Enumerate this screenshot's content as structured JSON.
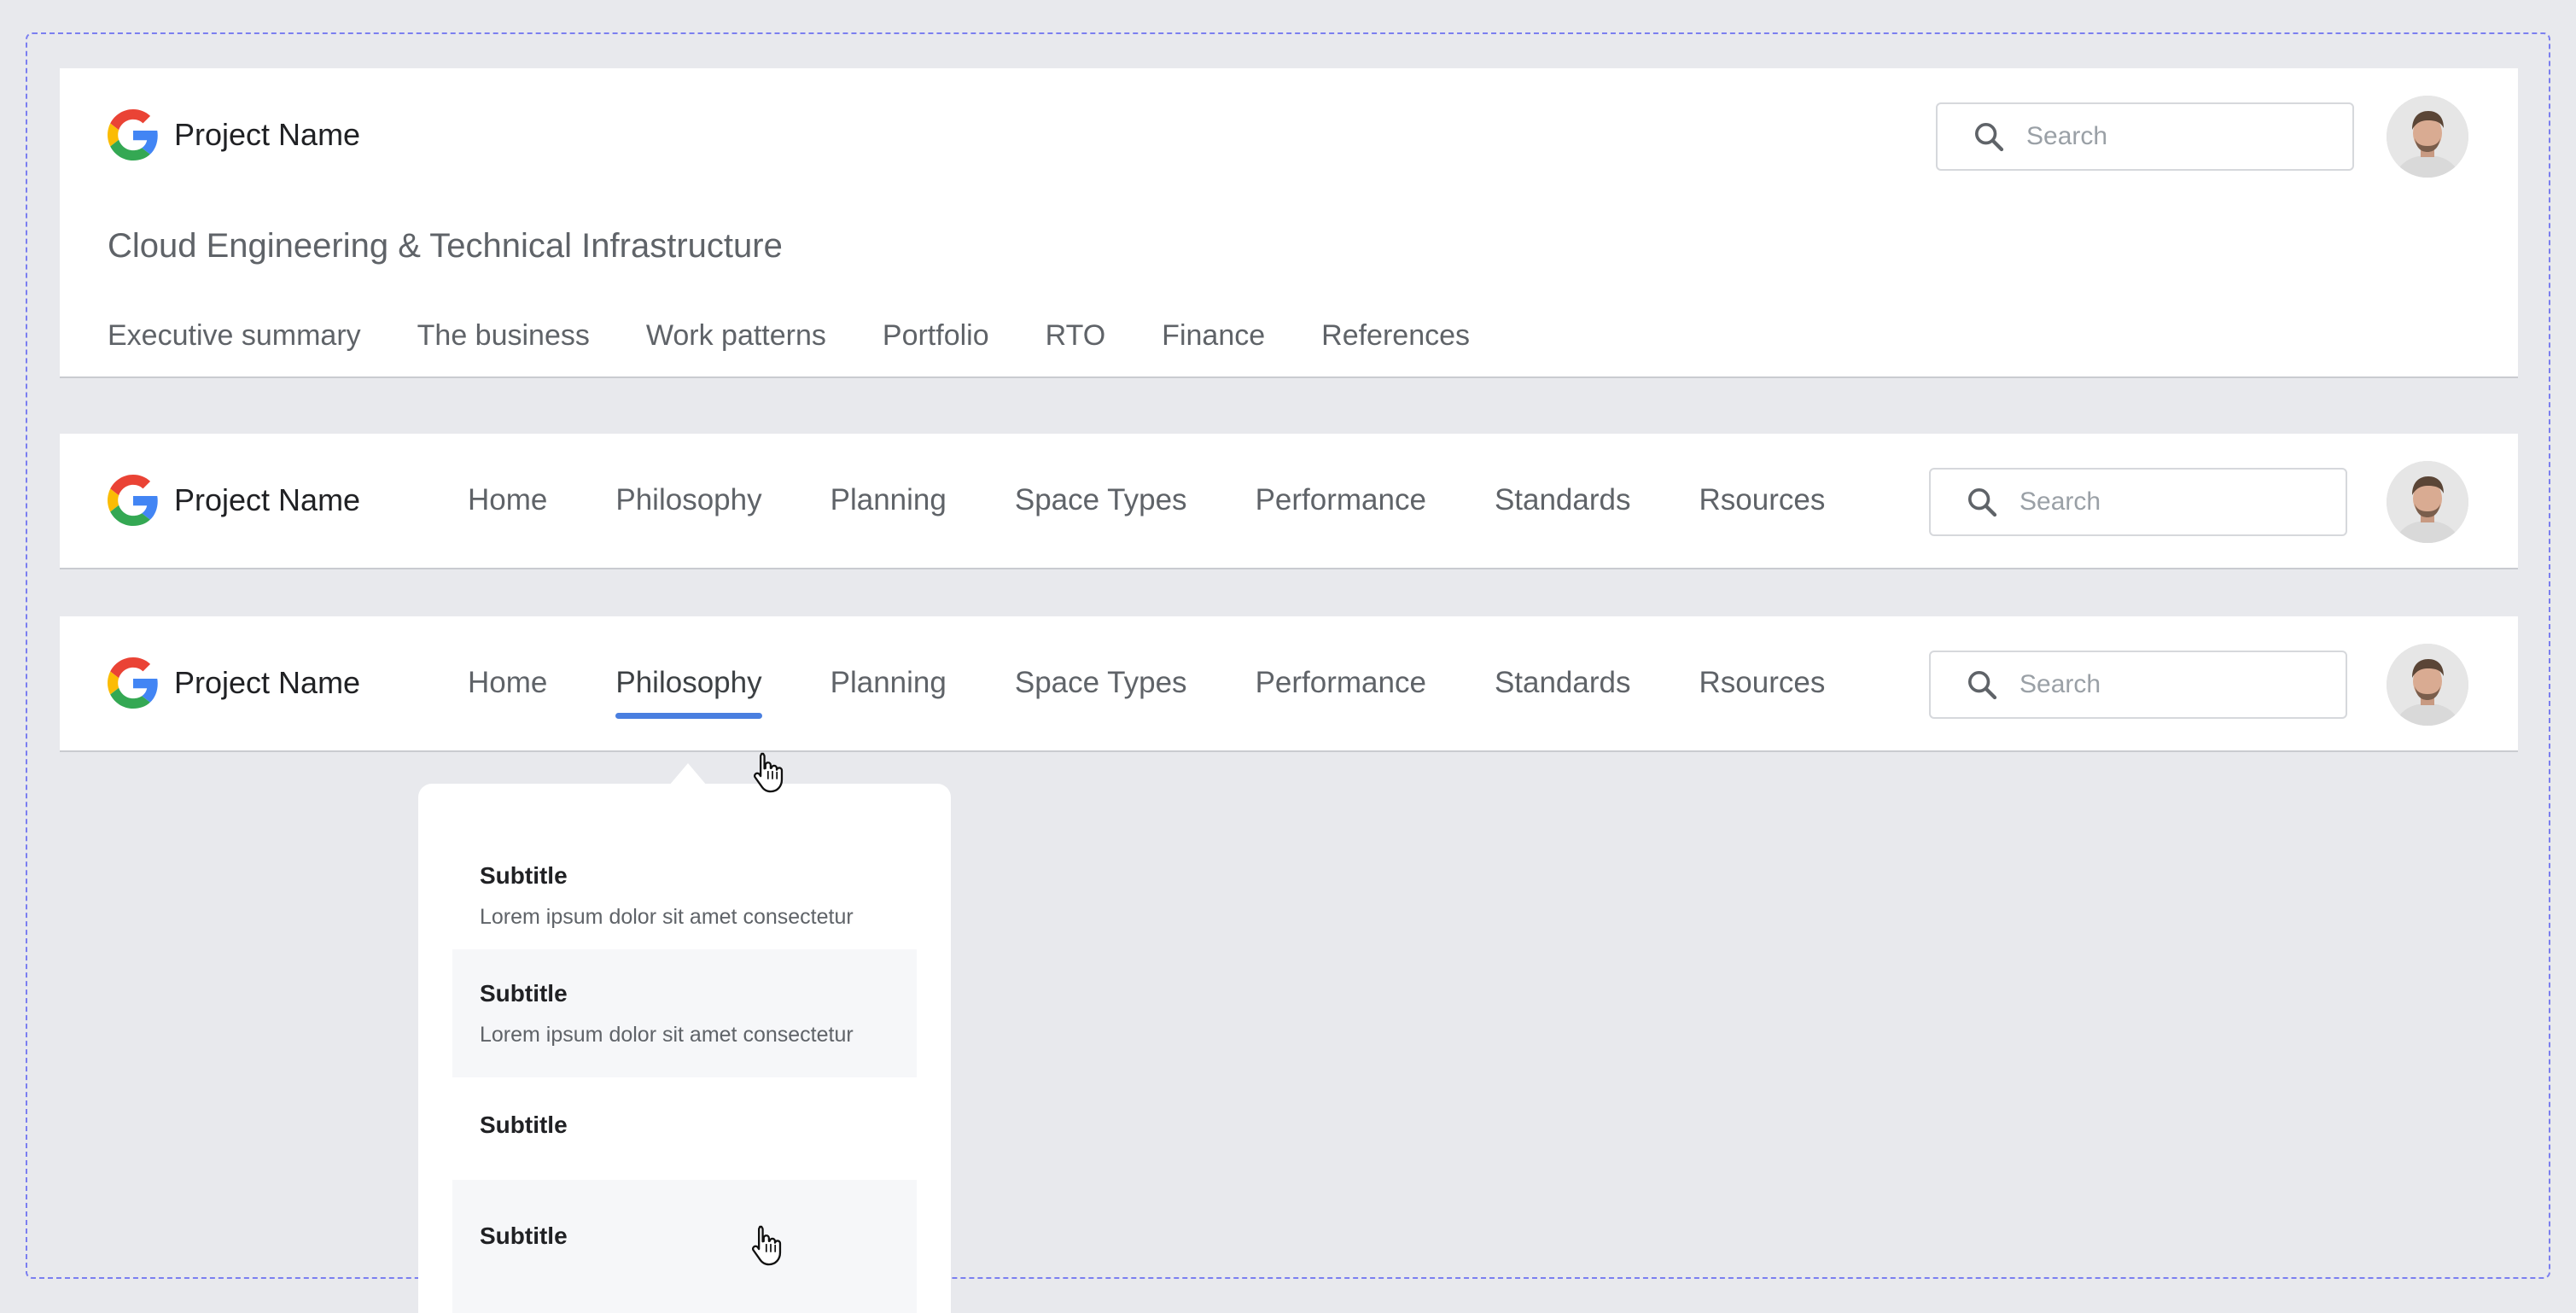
{
  "header_expanded": {
    "brand": "Project Name",
    "search_placeholder": "Search",
    "subtitle": "Cloud Engineering & Technical Infrastructure",
    "tabs": [
      "Executive summary",
      "The business",
      "Work patterns",
      "Portfolio",
      "RTO",
      "Finance",
      "References"
    ]
  },
  "header_compact": {
    "brand": "Project Name",
    "search_placeholder": "Search",
    "nav": [
      "Home",
      "Philosophy",
      "Planning",
      "Space Types",
      "Performance",
      "Standards",
      "Rsources"
    ]
  },
  "header_dropdown": {
    "brand": "Project Name",
    "search_placeholder": "Search",
    "nav": [
      "Home",
      "Philosophy",
      "Planning",
      "Space Types",
      "Performance",
      "Standards",
      "Rsources"
    ],
    "active_nav": "Philosophy",
    "dropdown_items": [
      {
        "title": "Subtitle",
        "desc": "Lorem ipsum dolor sit amet consectetur"
      },
      {
        "title": "Subtitle",
        "desc": "Lorem ipsum dolor sit amet consectetur"
      },
      {
        "title": "Subtitle",
        "desc": ""
      },
      {
        "title": "Subtitle",
        "desc": ""
      }
    ]
  },
  "icons": {
    "logo": "google-g-logo-icon",
    "search": "search-icon",
    "avatar": "user-avatar",
    "cursor": "hand-pointer-cursor-icon"
  },
  "colors": {
    "background": "#e8e9ed",
    "frame_dash": "#7b7ff0",
    "active_underline": "#4a7fe0",
    "hover_item": "#f6f7f9"
  }
}
